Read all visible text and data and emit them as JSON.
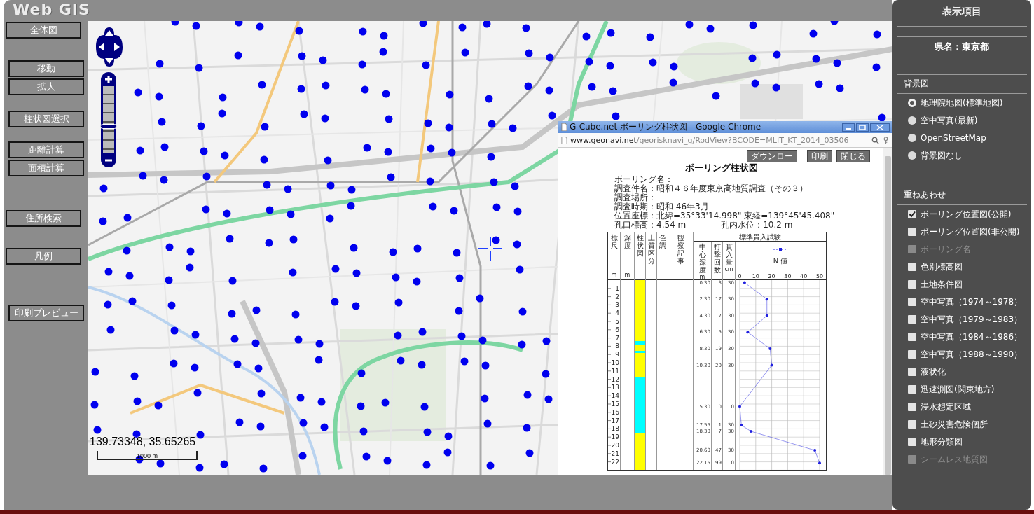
{
  "header": {
    "title": "Web GIS"
  },
  "toolbar": [
    {
      "buttons": [
        "全体図"
      ]
    },
    {
      "buttons": [
        "移動",
        "拡大"
      ]
    },
    {
      "buttons": [
        "柱状図選択"
      ]
    },
    {
      "buttons": [
        "距離計算",
        "面積計算"
      ]
    },
    {
      "buttons": [
        "住所検索"
      ]
    },
    {
      "buttons": [
        "凡例"
      ]
    },
    {
      "buttons": [
        "印刷プレビュー"
      ]
    }
  ],
  "map": {
    "zoom": {
      "level": 0.4
    },
    "coordinates": "139.73348, 35.65265",
    "scale": "1000 m"
  },
  "popup": {
    "title": "G-Cube.net ボーリング柱状図 - Google Chrome",
    "url_host": "www.geonavi.net",
    "url_path": "/georisknavi_g/RodView?BCODE=MLIT_KT_2014_03506",
    "buttons": [
      "ダウンロー",
      "印刷",
      "閉じる"
    ],
    "document": {
      "title": "ボーリング柱状図",
      "info": [
        "ボーリング名：",
        "調査件名：昭和４６年度東京高地質調査（その３）",
        "調査場所：",
        "調査時期：昭和 46年3月",
        "位置座標：北緯=35°33'14.998\" 東経=139°45'45.408\""
      ],
      "elevation": "孔口標高：4.54 m",
      "water_level": "孔内水位：10.2 m",
      "columns": [
        {
          "label": "標尺",
          "unit": "m"
        },
        {
          "label": "深度",
          "unit": "m"
        },
        {
          "label": "柱状図"
        },
        {
          "label": "土質区分"
        },
        {
          "label": "色調"
        },
        {
          "label": "観察記事"
        }
      ],
      "test": {
        "title": "標準貫入試験",
        "columns": [
          {
            "label": "中心深度",
            "unit": "m"
          },
          {
            "label": "打撃回数"
          },
          {
            "label": "貫入量",
            "unit": "cm"
          }
        ],
        "rows": [
          {
            "depth": "0.30",
            "blows": "3",
            "penetration": "30"
          },
          {
            "depth": "2.30",
            "blows": "17",
            "penetration": "30"
          },
          {
            "depth": "4.30",
            "blows": "17",
            "penetration": "30"
          },
          {
            "depth": "6.30",
            "blows": "5",
            "penetration": "30"
          },
          {
            "depth": "8.30",
            "blows": "19",
            "penetration": "30"
          },
          {
            "depth": "10.30",
            "blows": "20",
            "penetration": "30"
          },
          {
            "depth": "15.30",
            "blows": "0",
            "penetration": "0"
          },
          {
            "depth": "17.55",
            "blows": "1",
            "penetration": "30"
          },
          {
            "depth": "18.30",
            "blows": "7",
            "penetration": "30"
          },
          {
            "depth": "20.60",
            "blows": "47",
            "penetration": "30"
          },
          {
            "depth": "22.15",
            "blows": "99",
            "penetration": "0"
          }
        ],
        "n_label": "N 値",
        "n_ticks": [
          "0",
          "10",
          "20",
          "30",
          "40",
          "50"
        ],
        "scale": [
          "1",
          "2",
          "3",
          "4",
          "5",
          "6",
          "7",
          "8",
          "9",
          "10",
          "11",
          "12",
          "13",
          "14",
          "15",
          "16",
          "17",
          "18",
          "19",
          "20",
          "21",
          "22"
        ]
      }
    }
  },
  "panel": {
    "title": "表示項目",
    "prefecture": "県名：東京都",
    "background": {
      "title": "背景図",
      "options": [
        {
          "label": "地理院地図(標準地図)",
          "selected": true
        },
        {
          "label": "空中写真(最新)",
          "selected": false
        },
        {
          "label": "OpenStreetMap",
          "selected": false
        },
        {
          "label": "背景図なし",
          "selected": false
        }
      ]
    },
    "overlay": {
      "title": "重ねあわせ",
      "items": [
        {
          "label": "ボーリング位置図(公開)",
          "checked": true,
          "disabled": false
        },
        {
          "label": "ボーリング位置図(非公開)",
          "checked": false,
          "disabled": false
        },
        {
          "label": "ボーリング名",
          "checked": false,
          "disabled": true
        },
        {
          "label": "色別標高図",
          "checked": false,
          "disabled": false
        },
        {
          "label": "土地条件図",
          "checked": false,
          "disabled": false
        },
        {
          "label": "空中写真（1974～1978）",
          "checked": false,
          "disabled": false
        },
        {
          "label": "空中写真（1979～1983）",
          "checked": false,
          "disabled": false
        },
        {
          "label": "空中写真（1984～1986）",
          "checked": false,
          "disabled": false
        },
        {
          "label": "空中写真（1988～1990）",
          "checked": false,
          "disabled": false
        },
        {
          "label": "液状化",
          "checked": false,
          "disabled": false
        },
        {
          "label": "迅速測図(関東地方)",
          "checked": false,
          "disabled": false
        },
        {
          "label": "浸水想定区域",
          "checked": false,
          "disabled": false
        },
        {
          "label": "土砂災害危険個所",
          "checked": false,
          "disabled": false
        },
        {
          "label": "地形分類図",
          "checked": false,
          "disabled": false
        },
        {
          "label": "シームレス地質図",
          "checked": false,
          "disabled": true
        }
      ]
    }
  }
}
